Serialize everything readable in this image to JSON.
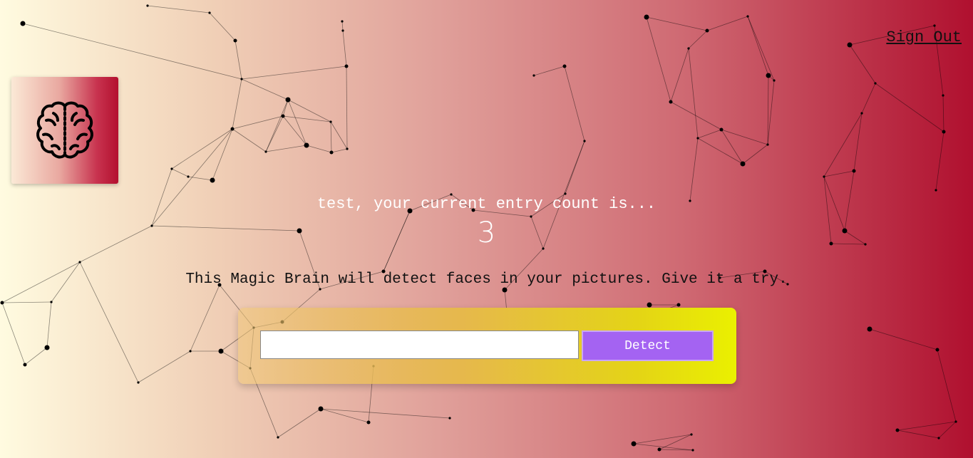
{
  "nav": {
    "sign_out_label": "Sign Out"
  },
  "logo": {
    "icon": "brain-icon"
  },
  "rank": {
    "message": "test, your current entry count is...",
    "count": "3"
  },
  "description": "This Magic Brain will detect faces in your pictures. Give it a try.",
  "form": {
    "input_value": "",
    "placeholder": "",
    "button_label": "Detect"
  },
  "colors": {
    "button": "#a463f2",
    "panel_end": "#eaf000",
    "background_end": "#b0102f"
  }
}
